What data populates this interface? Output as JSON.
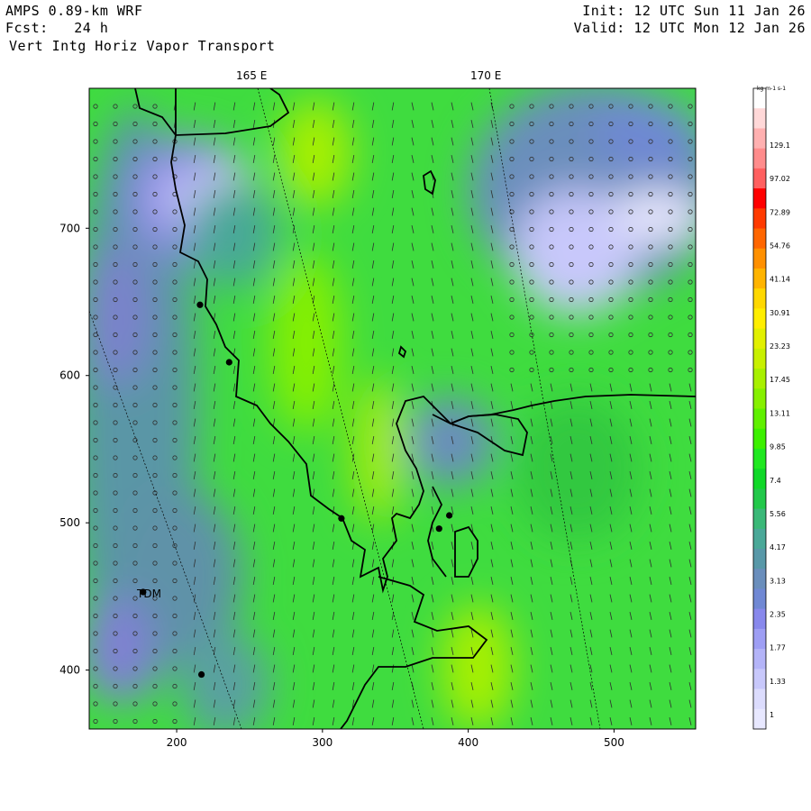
{
  "header": {
    "model": "AMPS 0.89-km WRF",
    "forecast": "Fcst:   24 h",
    "field": "Vert Intg Horiz Vapor Transport",
    "init": "Init: 12 UTC Sun 11 Jan 26",
    "valid": "Valid: 12 UTC Mon 12 Jan 26"
  },
  "map": {
    "lon_labels": [
      "165 E",
      "170 E"
    ],
    "x_ticks": [
      "200",
      "300",
      "400",
      "500"
    ],
    "y_ticks": [
      "700",
      "600",
      "500",
      "400"
    ],
    "x_range": [
      140,
      556
    ],
    "y_range": [
      360,
      795
    ],
    "station_label": "TDM",
    "stations": [
      {
        "x": 216,
        "y": 648
      },
      {
        "x": 236,
        "y": 609
      },
      {
        "x": 313,
        "y": 503
      },
      {
        "x": 380,
        "y": 496
      },
      {
        "x": 387,
        "y": 505
      },
      {
        "x": 177,
        "y": 453
      },
      {
        "x": 217,
        "y": 397
      }
    ]
  },
  "colorbar": {
    "units": "kg m-1 s-1",
    "levels": [
      "129.1",
      "97.02",
      "72.89",
      "54.76",
      "41.14",
      "30.91",
      "23.23",
      "17.45",
      "13.11",
      "9.85",
      "7.4",
      "5.56",
      "4.17",
      "3.13",
      "2.35",
      "1.77",
      "1.33",
      "1"
    ],
    "colors": [
      "#ffffff",
      "#ffd8d8",
      "#ffb0b0",
      "#ff8c8c",
      "#ff6060",
      "#ff0000",
      "#ff3a00",
      "#ff6600",
      "#ff9000",
      "#ffb400",
      "#ffd800",
      "#ffee00",
      "#e2f000",
      "#c8f000",
      "#a8f000",
      "#86f000",
      "#60f000",
      "#3cf000",
      "#20e820",
      "#10d828",
      "#22c84a",
      "#3ab878",
      "#4aa898",
      "#5898a8",
      "#6a8ebc",
      "#7088d4",
      "#8888ec",
      "#9e9ef4",
      "#b4b4f8",
      "#c8c8fb",
      "#dcdcfd",
      "#e8e8ff"
    ]
  }
}
